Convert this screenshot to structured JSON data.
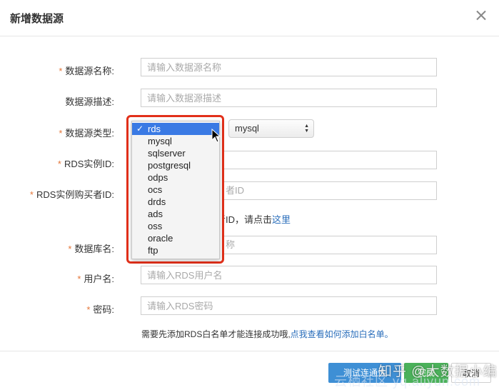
{
  "dialog": {
    "title": "新增数据源"
  },
  "form": {
    "name": {
      "required": true,
      "label": "数据源名称:",
      "placeholder": "请输入数据源名称"
    },
    "description": {
      "required": false,
      "label": "数据源描述:",
      "placeholder": "请输入数据源描述"
    },
    "type": {
      "required": true,
      "label": "数据源类型:",
      "selected_value": "mysql"
    },
    "rds_instance": {
      "required": true,
      "label": "RDS实例ID:"
    },
    "rds_buyer": {
      "required": true,
      "label": "RDS实例购买者ID:",
      "partial_placeholder": "者ID"
    },
    "help": {
      "partial_text": "买者ID，请点击",
      "link": "这里"
    },
    "database": {
      "required": true,
      "label": "数据库名:",
      "partial_placeholder": "称"
    },
    "username": {
      "required": true,
      "label": "用户名:",
      "placeholder": "请输入RDS用户名"
    },
    "password": {
      "required": true,
      "label": "密码:",
      "placeholder": "请输入RDS密码"
    },
    "notice": {
      "text": "需要先添加RDS白名单才能连接成功哦,",
      "link": "点我查看如何添加白名单。"
    }
  },
  "dropdown": {
    "options": [
      "rds",
      "mysql",
      "sqlserver",
      "postgresql",
      "odps",
      "ocs",
      "drds",
      "ads",
      "oss",
      "oracle",
      "ftp"
    ],
    "selected": "rds",
    "check_glyph": "✓"
  },
  "footer": {
    "test_label": "测试连通性",
    "done_label": "完成",
    "cancel_label": "取消"
  },
  "watermark": {
    "line1": "知乎 @大数据小编",
    "line2": "云栖社区 yq.aliyun.com"
  },
  "colors": {
    "required_star": "#e4773a",
    "link": "#2a6ebb",
    "highlight_frame": "#e2301a",
    "selected_option": "#3a7ae4",
    "test_button": "#3e8fd5",
    "done_button": "#4bb15a"
  },
  "icons": {
    "close": "close-icon",
    "cursor": "mouse-pointer-icon",
    "select_arrows": "updown-arrows-icon"
  }
}
